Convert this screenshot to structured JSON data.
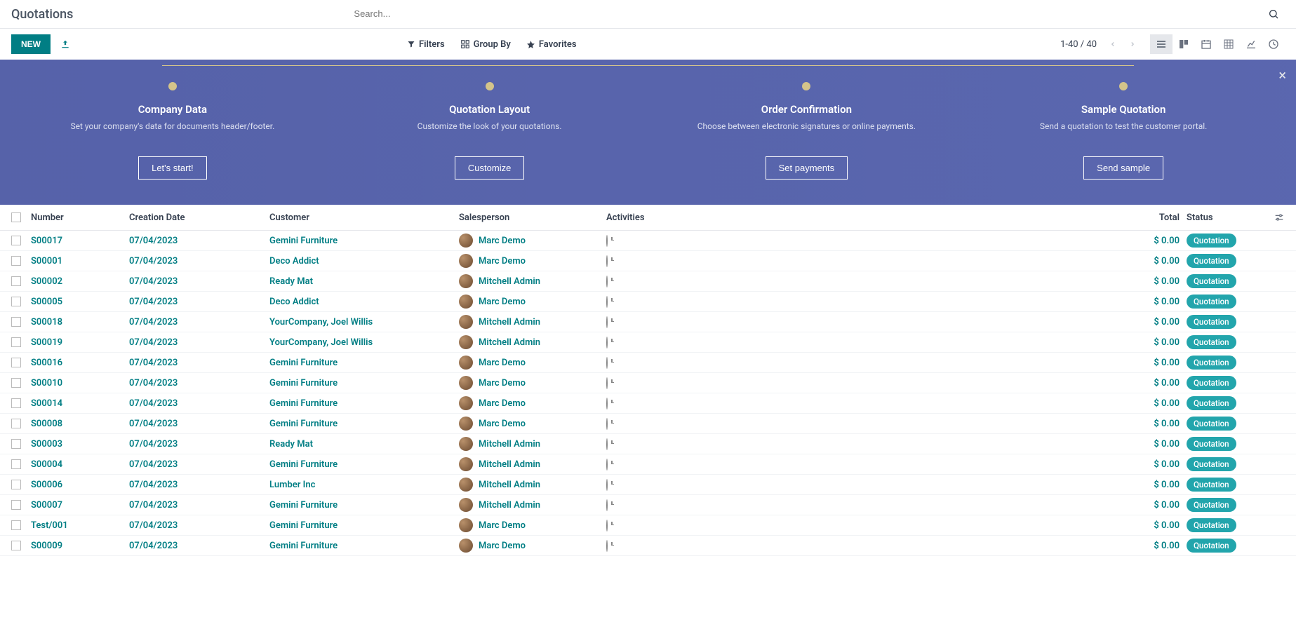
{
  "header": {
    "title": "Quotations",
    "search_placeholder": "Search..."
  },
  "toolbar": {
    "new_label": "NEW",
    "filters_label": "Filters",
    "groupby_label": "Group By",
    "favorites_label": "Favorites",
    "pager_text": "1-40 / 40"
  },
  "onboarding": {
    "steps": [
      {
        "title": "Company Data",
        "desc": "Set your company's data for documents header/footer.",
        "button": "Let's start!"
      },
      {
        "title": "Quotation Layout",
        "desc": "Customize the look of your quotations.",
        "button": "Customize"
      },
      {
        "title": "Order Confirmation",
        "desc": "Choose between electronic signatures or online payments.",
        "button": "Set payments"
      },
      {
        "title": "Sample Quotation",
        "desc": "Send a quotation to test the customer portal.",
        "button": "Send sample"
      }
    ]
  },
  "table": {
    "headers": {
      "number": "Number",
      "creation_date": "Creation Date",
      "customer": "Customer",
      "salesperson": "Salesperson",
      "activities": "Activities",
      "total": "Total",
      "status": "Status"
    },
    "rows": [
      {
        "number": "S00017",
        "date": "07/04/2023",
        "customer": "Gemini Furniture",
        "salesperson": "Marc Demo",
        "total": "$ 0.00",
        "status": "Quotation"
      },
      {
        "number": "S00001",
        "date": "07/04/2023",
        "customer": "Deco Addict",
        "salesperson": "Marc Demo",
        "total": "$ 0.00",
        "status": "Quotation"
      },
      {
        "number": "S00002",
        "date": "07/04/2023",
        "customer": "Ready Mat",
        "salesperson": "Mitchell Admin",
        "total": "$ 0.00",
        "status": "Quotation"
      },
      {
        "number": "S00005",
        "date": "07/04/2023",
        "customer": "Deco Addict",
        "salesperson": "Marc Demo",
        "total": "$ 0.00",
        "status": "Quotation"
      },
      {
        "number": "S00018",
        "date": "07/04/2023",
        "customer": "YourCompany, Joel Willis",
        "salesperson": "Mitchell Admin",
        "total": "$ 0.00",
        "status": "Quotation"
      },
      {
        "number": "S00019",
        "date": "07/04/2023",
        "customer": "YourCompany, Joel Willis",
        "salesperson": "Mitchell Admin",
        "total": "$ 0.00",
        "status": "Quotation"
      },
      {
        "number": "S00016",
        "date": "07/04/2023",
        "customer": "Gemini Furniture",
        "salesperson": "Marc Demo",
        "total": "$ 0.00",
        "status": "Quotation"
      },
      {
        "number": "S00010",
        "date": "07/04/2023",
        "customer": "Gemini Furniture",
        "salesperson": "Marc Demo",
        "total": "$ 0.00",
        "status": "Quotation"
      },
      {
        "number": "S00014",
        "date": "07/04/2023",
        "customer": "Gemini Furniture",
        "salesperson": "Marc Demo",
        "total": "$ 0.00",
        "status": "Quotation"
      },
      {
        "number": "S00008",
        "date": "07/04/2023",
        "customer": "Gemini Furniture",
        "salesperson": "Marc Demo",
        "total": "$ 0.00",
        "status": "Quotation"
      },
      {
        "number": "S00003",
        "date": "07/04/2023",
        "customer": "Ready Mat",
        "salesperson": "Mitchell Admin",
        "total": "$ 0.00",
        "status": "Quotation"
      },
      {
        "number": "S00004",
        "date": "07/04/2023",
        "customer": "Gemini Furniture",
        "salesperson": "Mitchell Admin",
        "total": "$ 0.00",
        "status": "Quotation"
      },
      {
        "number": "S00006",
        "date": "07/04/2023",
        "customer": "Lumber Inc",
        "salesperson": "Mitchell Admin",
        "total": "$ 0.00",
        "status": "Quotation"
      },
      {
        "number": "S00007",
        "date": "07/04/2023",
        "customer": "Gemini Furniture",
        "salesperson": "Mitchell Admin",
        "total": "$ 0.00",
        "status": "Quotation"
      },
      {
        "number": "Test/001",
        "date": "07/04/2023",
        "customer": "Gemini Furniture",
        "salesperson": "Marc Demo",
        "total": "$ 0.00",
        "status": "Quotation"
      },
      {
        "number": "S00009",
        "date": "07/04/2023",
        "customer": "Gemini Furniture",
        "salesperson": "Marc Demo",
        "total": "$ 0.00",
        "status": "Quotation"
      }
    ]
  }
}
